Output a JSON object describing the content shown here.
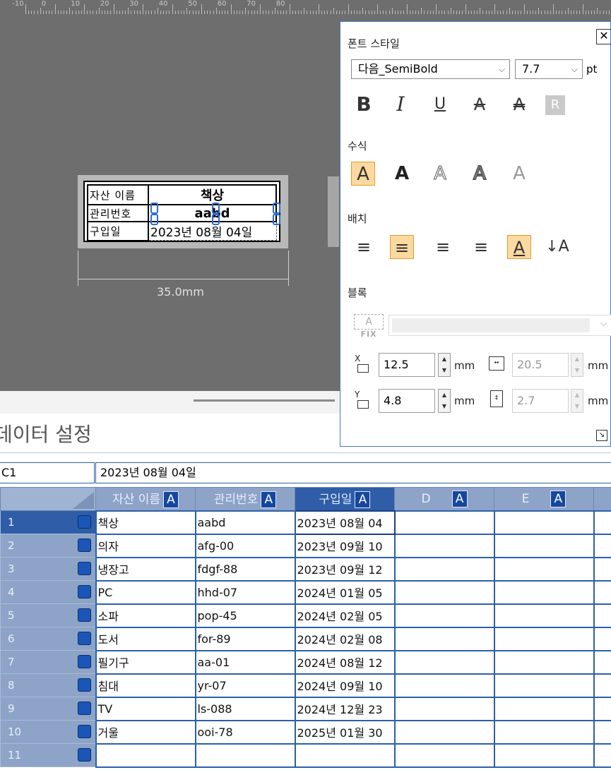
{
  "ruler": {
    "labels": [
      "-10",
      "0",
      "10",
      "20",
      "30",
      "40",
      "50",
      "60",
      "70",
      "80"
    ]
  },
  "label": {
    "rows": [
      {
        "head": "자산 이름",
        "value": "책상"
      },
      {
        "head": "관리번호",
        "value": "aabd"
      },
      {
        "head": "구입일",
        "value": "2023년 08월 04일"
      }
    ],
    "width_text": "35.0mm"
  },
  "panel": {
    "font_style_title": "폰트 스타일",
    "font_name": "다음_SemiBold",
    "font_size": "7.7",
    "size_unit": "pt",
    "format_buttons": [
      "B",
      "I",
      "U",
      "A",
      "A",
      "R"
    ],
    "effect_title": "수식",
    "effect_buttons": [
      "A",
      "A",
      "A",
      "A",
      "A"
    ],
    "align_title": "배치",
    "align_buttons": [
      "≡",
      "≡",
      "≡",
      "≡",
      "A",
      "↓A"
    ],
    "block_title": "블록",
    "fix_label": "FIX",
    "fix_glyph": "A",
    "x_value": "12.5",
    "y_value": "4.8",
    "w_value": "20.5",
    "h_value": "2.7",
    "unit": "mm",
    "x_axis": "X",
    "y_axis": "Y"
  },
  "data_settings": {
    "title": "데이터 설정",
    "cell_ref": "C1",
    "formula": "2023년 08월 04일",
    "badge": "A",
    "columns": [
      "자산 이름",
      "관리번호",
      "구입일",
      "D",
      "E"
    ],
    "rows": [
      {
        "num": "1",
        "cells": [
          "책상",
          "aabd",
          "2023년 08월 04",
          "",
          ""
        ]
      },
      {
        "num": "2",
        "cells": [
          "의자",
          "afg-00",
          "2023년 09월 10",
          "",
          ""
        ]
      },
      {
        "num": "3",
        "cells": [
          "냉장고",
          "fdgf-88",
          "2023년 09월 12",
          "",
          ""
        ]
      },
      {
        "num": "4",
        "cells": [
          "PC",
          "hhd-07",
          "2024년 01월 05",
          "",
          ""
        ]
      },
      {
        "num": "5",
        "cells": [
          "소파",
          "pop-45",
          "2024년 02월 05",
          "",
          ""
        ]
      },
      {
        "num": "6",
        "cells": [
          "도서",
          "for-89",
          "2024년 02월 08",
          "",
          ""
        ]
      },
      {
        "num": "7",
        "cells": [
          "필기구",
          "aa-01",
          "2024년 08월 12",
          "",
          ""
        ]
      },
      {
        "num": "8",
        "cells": [
          "침대",
          "yr-07",
          "2024년 09월 10",
          "",
          ""
        ]
      },
      {
        "num": "9",
        "cells": [
          "TV",
          "ls-088",
          "2024년 12월 23",
          "",
          ""
        ]
      },
      {
        "num": "10",
        "cells": [
          "거울",
          "ooi-78",
          "2025년 01월 30",
          "",
          ""
        ]
      },
      {
        "num": "11",
        "cells": [
          "",
          "",
          "",
          "",
          ""
        ]
      }
    ]
  }
}
